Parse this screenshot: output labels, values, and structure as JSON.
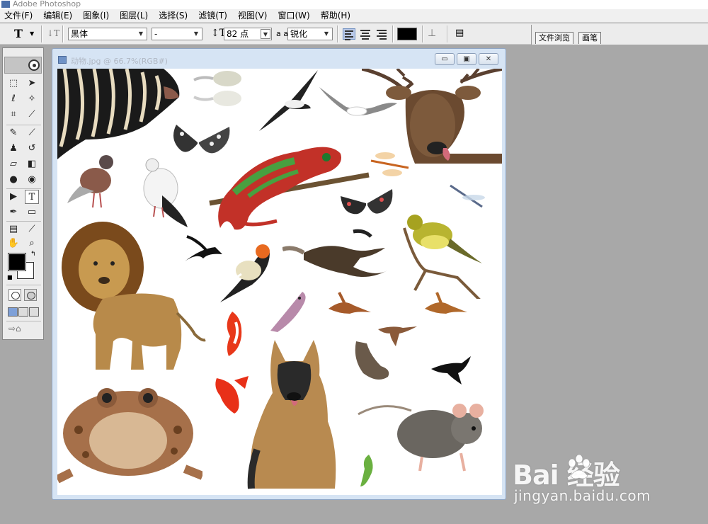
{
  "app": {
    "title": "Adobe Photoshop"
  },
  "menu": [
    "文件(F)",
    "编辑(E)",
    "图象(I)",
    "图层(L)",
    "选择(S)",
    "滤镜(T)",
    "视图(V)",
    "窗口(W)",
    "帮助(H)"
  ],
  "options": {
    "tool_glyph": "T",
    "font_family": "黑体",
    "font_style": "-",
    "font_size": "82 点",
    "aa_label": "a a",
    "anti_alias": "锐化",
    "text_color": "#000000"
  },
  "palette_well": {
    "tabs": [
      "文件浏览",
      "画笔"
    ]
  },
  "document": {
    "title": "动物.jpg @ 66.7%(RGB#)",
    "min_glyph": "▭",
    "max_glyph": "▣",
    "close_glyph": "✕"
  },
  "watermark": {
    "logo": "Bai  经验",
    "url": "jingyan.baidu.com"
  },
  "colors": {
    "foreground": "#000000",
    "background": "#ffffff",
    "app_bg": "#a8a8a8"
  }
}
